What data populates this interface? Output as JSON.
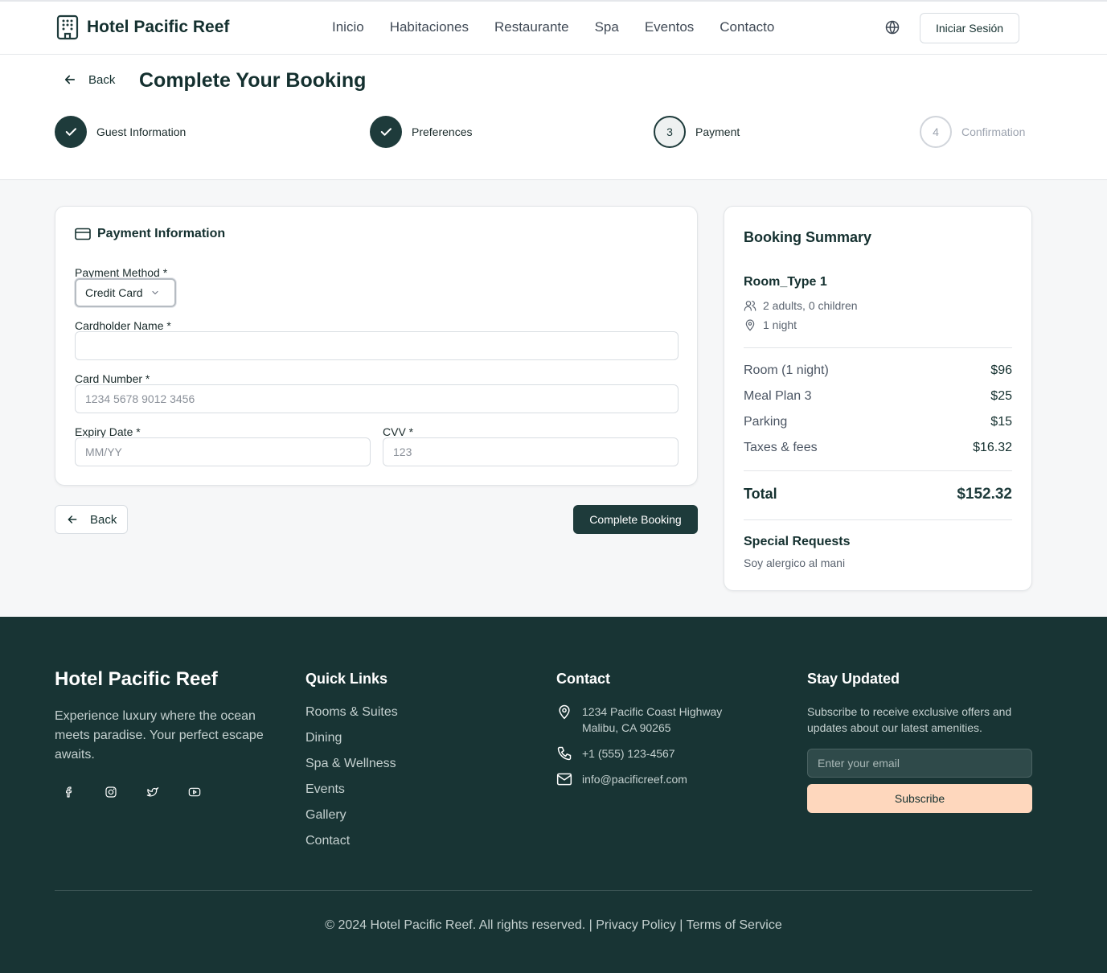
{
  "header": {
    "brand": "Hotel Pacific Reef",
    "nav": [
      "Inicio",
      "Habitaciones",
      "Restaurante",
      "Spa",
      "Eventos",
      "Contacto"
    ],
    "login_label": "Iniciar Sesión"
  },
  "booking": {
    "back_label": "Back",
    "title": "Complete Your Booking",
    "steps": [
      {
        "label": "Guest Information",
        "state": "done"
      },
      {
        "label": "Preferences",
        "state": "done"
      },
      {
        "label": "Payment",
        "number": "3",
        "state": "current"
      },
      {
        "label": "Confirmation",
        "number": "4",
        "state": "future"
      }
    ]
  },
  "payment": {
    "title": "Payment Information",
    "method_label": "Payment Method *",
    "method_value": "Credit Card",
    "cardholder_label": "Cardholder Name *",
    "cardholder_value": "",
    "card_number_label": "Card Number *",
    "card_number_placeholder": "1234 5678 9012 3456",
    "expiry_label": "Expiry Date *",
    "expiry_placeholder": "MM/YY",
    "cvv_label": "CVV *",
    "cvv_placeholder": "123",
    "back_label": "Back",
    "complete_label": "Complete Booking"
  },
  "summary": {
    "title": "Booking Summary",
    "room_type": "Room_Type 1",
    "guests": "2 adults, 0 children",
    "nights": "1 night",
    "lines": [
      {
        "label": "Room (1 night)",
        "value": "$96"
      },
      {
        "label": "Meal Plan 3",
        "value": "$25"
      },
      {
        "label": "Parking",
        "value": "$15"
      },
      {
        "label": "Taxes & fees",
        "value": "$16.32"
      }
    ],
    "total_label": "Total",
    "total_value": "$152.32",
    "special_requests_title": "Special Requests",
    "special_requests_text": "Soy alergico al mani"
  },
  "footer": {
    "brand": "Hotel Pacific Reef",
    "description": "Experience luxury where the ocean meets paradise. Your perfect escape awaits.",
    "quick_links_title": "Quick Links",
    "quick_links": [
      "Rooms & Suites",
      "Dining",
      "Spa & Wellness",
      "Events",
      "Gallery",
      "Contact"
    ],
    "contact_title": "Contact",
    "address_line1": "1234 Pacific Coast Highway",
    "address_line2": "Malibu, CA 90265",
    "phone": "+1 (555) 123-4567",
    "email": "info@pacificreef.com",
    "newsletter_title": "Stay Updated",
    "newsletter_text": "Subscribe to receive exclusive offers and updates about our latest amenities.",
    "email_placeholder": "Enter your email",
    "subscribe_label": "Subscribe",
    "copyright": "© 2024 Hotel Pacific Reef. All rights reserved.",
    "separator": "|",
    "privacy": "Privacy Policy",
    "terms": "Terms of Service"
  },
  "colors": {
    "primary": "#1e3b3b",
    "footer_bg": "#183434",
    "accent": "#fed7bd"
  }
}
